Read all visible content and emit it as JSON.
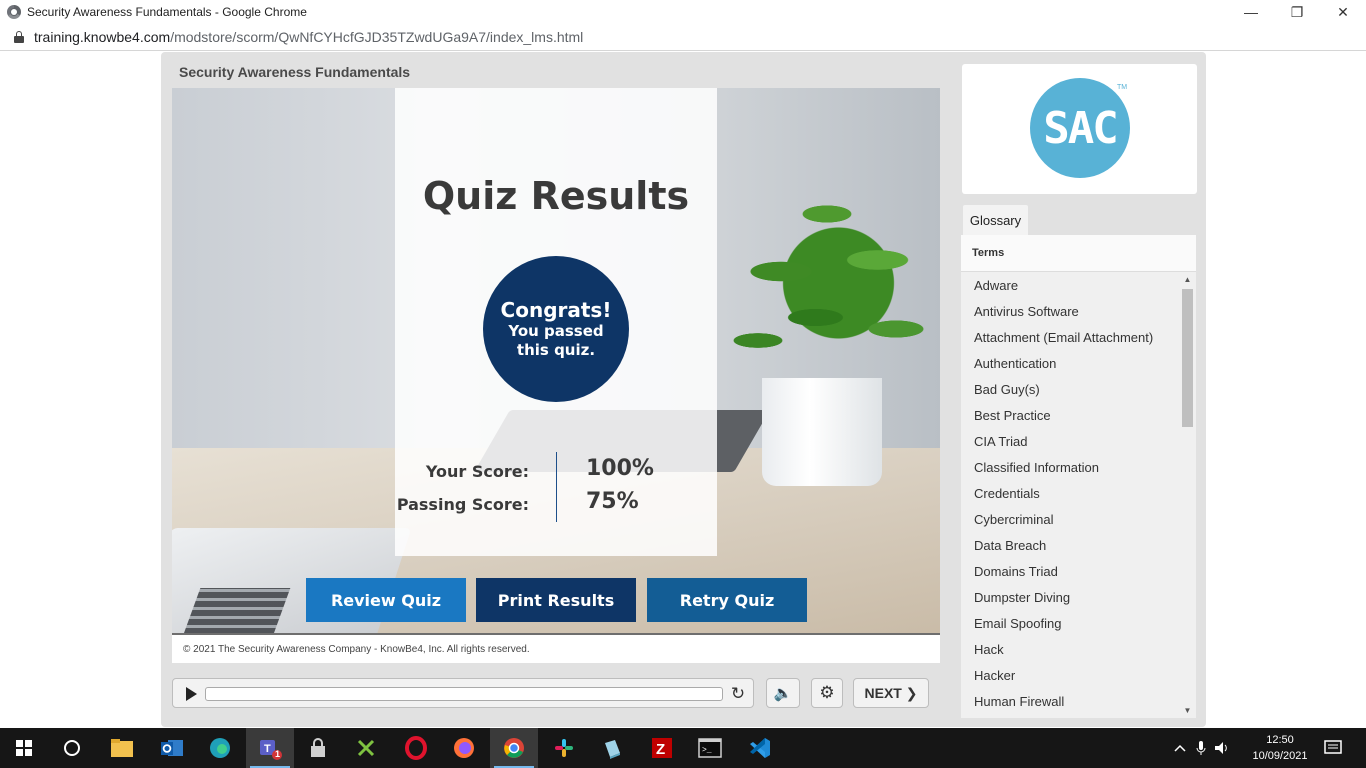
{
  "browser": {
    "window_title": "Security Awareness Fundamentals - Google Chrome",
    "url_host": "training.knowbe4.com",
    "url_path": "/modstore/scorm/QwNfCYHcfGJD35TZwdUGa9A7/index_lms.html",
    "controls": {
      "minimize": "—",
      "restore": "❐",
      "close": "✕"
    }
  },
  "player": {
    "course_title": "Security Awareness Fundamentals",
    "slide": {
      "heading": "Quiz Results",
      "congrats_title": "Congrats!",
      "congrats_line1": "You passed",
      "congrats_line2": "this quiz.",
      "your_score_label": "Your Score:",
      "your_score_value": "100%",
      "passing_score_label": "Passing Score:",
      "passing_score_value": "75%",
      "buttons": {
        "review": "Review Quiz",
        "print": "Print Results",
        "retry": "Retry Quiz"
      },
      "colors": {
        "circle": "#0e3566",
        "review": "#1a78c2",
        "print": "#0e3566",
        "retry": "#135d95"
      }
    },
    "copyright": "© 2021 The Security Awareness Company - KnowBe4, Inc. All rights reserved.",
    "controls": {
      "play_icon": "play-icon",
      "replay_glyph": "↻",
      "volume_glyph": "🔈",
      "settings_glyph": "⚙",
      "next_label": "NEXT ❯",
      "progress": 0
    }
  },
  "sidebar": {
    "logo_text": "SAC",
    "logo_tm": "TM",
    "tab_label": "Glossary",
    "terms_header": "Terms",
    "terms": [
      "Adware",
      "Antivirus Software",
      "Attachment (Email Attachment)",
      "Authentication",
      "Bad Guy(s)",
      "Best Practice",
      "CIA Triad",
      "Classified Information",
      "Credentials",
      "Cybercriminal",
      "Data Breach",
      "Domains Triad",
      "Dumpster Diving",
      "Email Spoofing",
      "Hack",
      "Hacker",
      "Human Firewall"
    ],
    "scroll_up": "▲",
    "scroll_down": "▼"
  },
  "taskbar": {
    "clock_time": "12:50",
    "clock_date": "10/09/2021",
    "teams_badge": "1"
  }
}
